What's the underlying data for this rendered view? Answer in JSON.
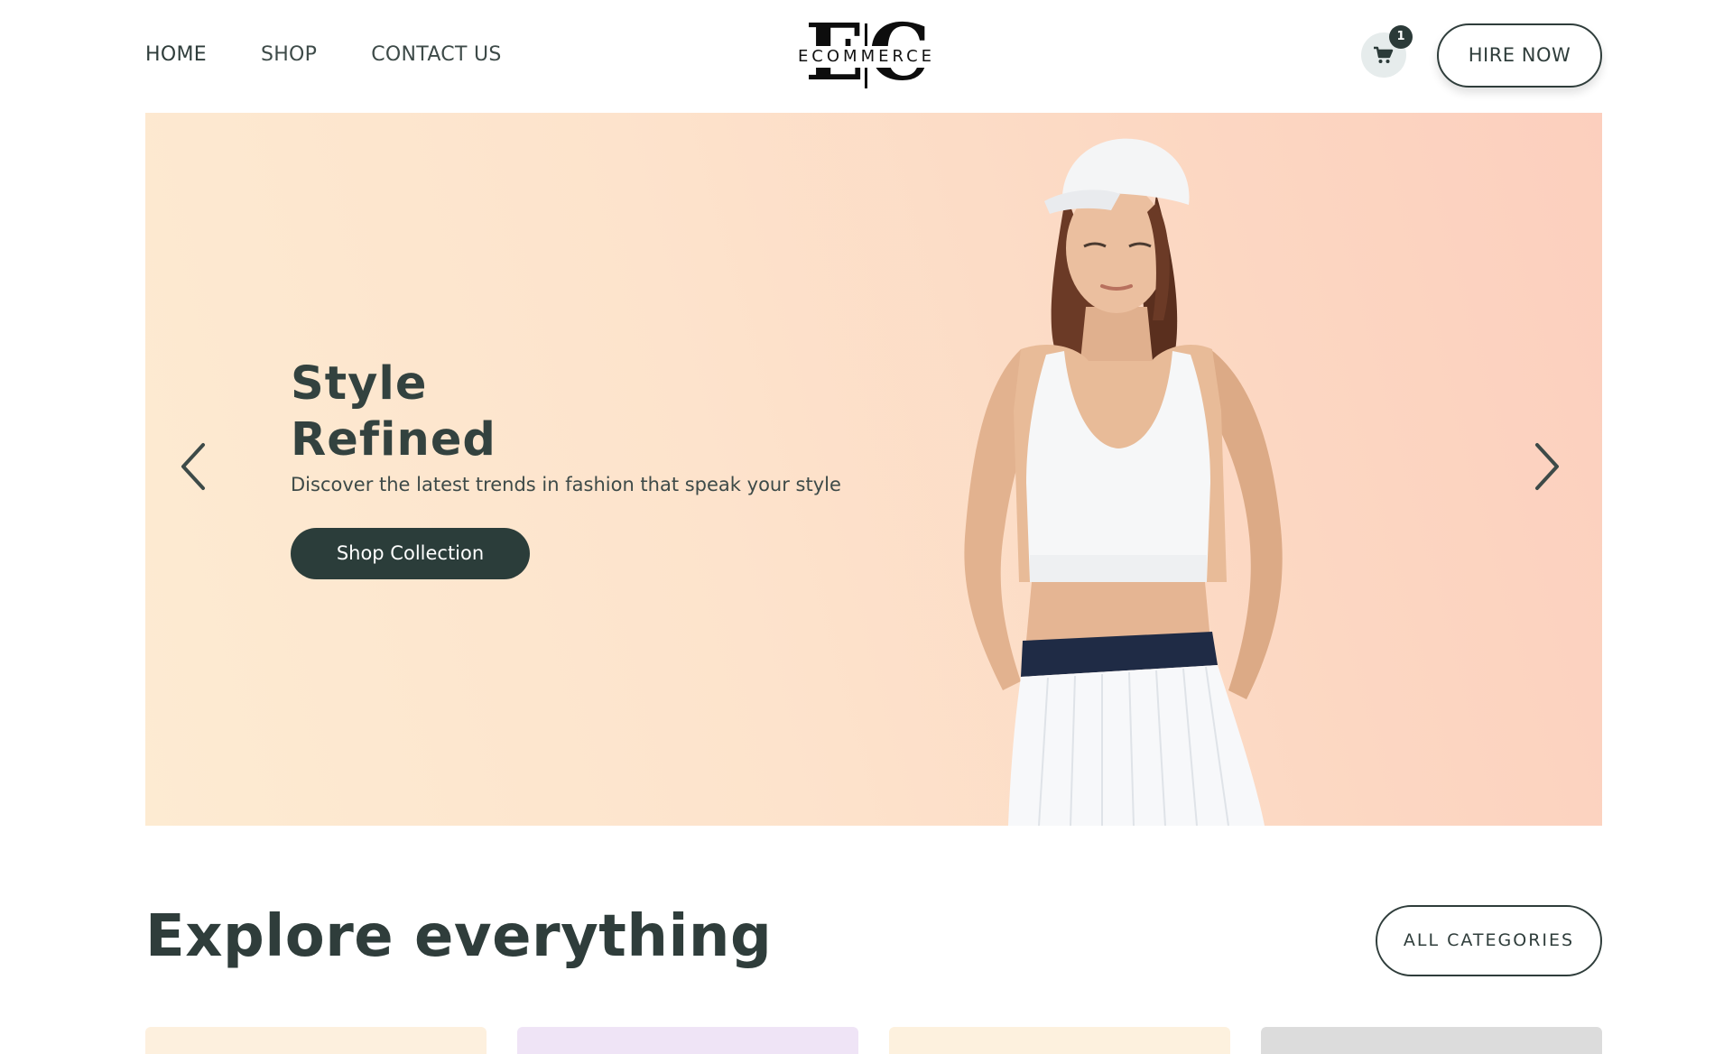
{
  "nav": {
    "items": [
      {
        "label": "HOME"
      },
      {
        "label": "SHOP"
      },
      {
        "label": "CONTACT US"
      }
    ]
  },
  "logo": {
    "monogram_left": "E",
    "monogram_right": "C",
    "wordmark": "ECOMMERCE"
  },
  "cart": {
    "icon": "shopping-cart-icon",
    "count": "1"
  },
  "header": {
    "hire_label": "HIRE NOW"
  },
  "hero": {
    "title_line1": "Style",
    "title_line2": "Refined",
    "subtitle": "Discover the latest trends in fashion that speak your style",
    "cta_label": "Shop Collection",
    "prev_icon": "chevron-left-icon",
    "next_icon": "chevron-right-icon",
    "gradient_colors": [
      "#fdebd2",
      "#fccfbe"
    ]
  },
  "explore": {
    "title": "Explore everything",
    "all_categories_label": "ALL CATEGORIES",
    "card_colors": [
      "#fdf0de",
      "#efe4f6",
      "#fdf1de",
      "#dcdcdc"
    ]
  },
  "colors": {
    "accent_dark": "#2b3d3a",
    "text": "#2f3d3b"
  }
}
